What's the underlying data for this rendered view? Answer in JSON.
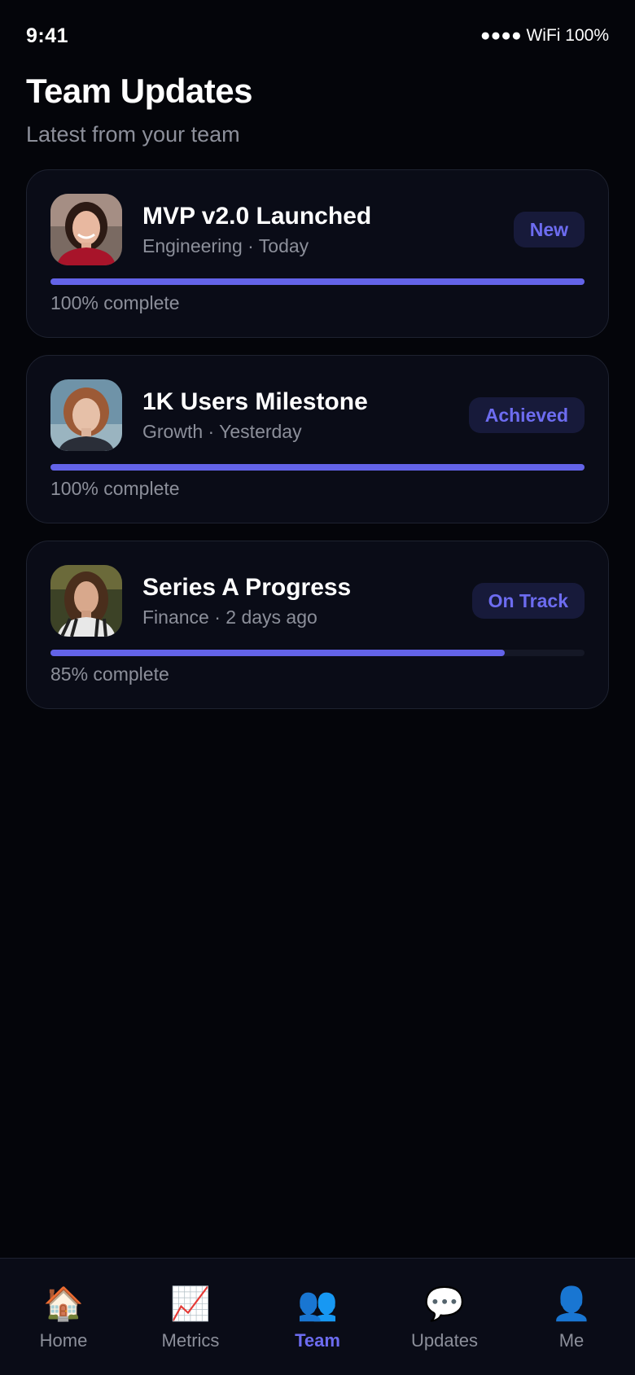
{
  "status_bar": {
    "time": "9:41",
    "indicators": "●●●● WiFi 100%"
  },
  "header": {
    "title": "Team Updates",
    "subtitle": "Latest from your team"
  },
  "updates": [
    {
      "title": "MVP v2.0 Launched",
      "meta": "Engineering · Today",
      "badge": "New",
      "progress": 100,
      "progress_label": "100% complete",
      "avatar": "woman-smiling-red-top"
    },
    {
      "title": "1K Users Milestone",
      "meta": "Growth · Yesterday",
      "badge": "Achieved",
      "progress": 100,
      "progress_label": "100% complete",
      "avatar": "woman-auburn-hair"
    },
    {
      "title": "Series A Progress",
      "meta": "Finance · 2 days ago",
      "badge": "On Track",
      "progress": 85,
      "progress_label": "85% complete",
      "avatar": "woman-long-brown-hair"
    }
  ],
  "tabs": [
    {
      "label": "Home",
      "icon": "🏠",
      "icon_name": "house-icon",
      "active": false
    },
    {
      "label": "Metrics",
      "icon": "📈",
      "icon_name": "chart-icon",
      "active": false
    },
    {
      "label": "Team",
      "icon": "👥",
      "icon_name": "people-icon",
      "active": true
    },
    {
      "label": "Updates",
      "icon": "💬",
      "icon_name": "speech-bubble-icon",
      "active": false
    },
    {
      "label": "Me",
      "icon": "👤",
      "icon_name": "person-icon",
      "active": false
    }
  ],
  "colors": {
    "accent": "#6363e8",
    "badge_bg": "#171a3a",
    "card_bg": "#0a0c17",
    "background": "#04050a"
  }
}
